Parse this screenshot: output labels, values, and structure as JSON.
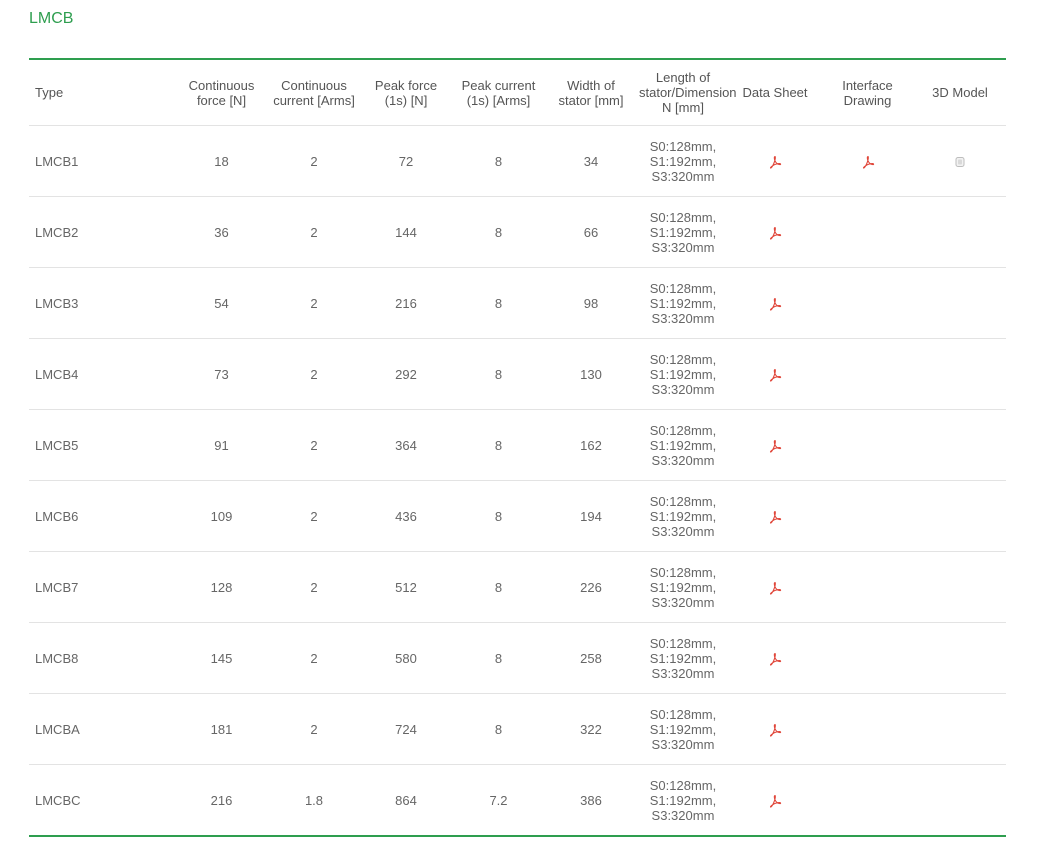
{
  "section_title": "LMCB",
  "headers": {
    "type": "Type",
    "cont_force": [
      "Continuous",
      "force [N]"
    ],
    "cont_current": [
      "Continuous",
      "current [Arms]"
    ],
    "peak_force": [
      "Peak force",
      "(1s) [N]"
    ],
    "peak_current": [
      "Peak current",
      "(1s) [Arms]"
    ],
    "width": [
      "Width of",
      "stator [mm]"
    ],
    "length": [
      "Length of",
      "stator/Dimension",
      "N [mm]"
    ],
    "datasheet": "Data Sheet",
    "interface": [
      "Interface",
      "Drawing"
    ],
    "model": "3D Model"
  },
  "rows": [
    {
      "type": "LMCB1",
      "cont_force": "18",
      "cont_current": "2",
      "peak_force": "72",
      "peak_current": "8",
      "width": "34",
      "length": [
        "S0:128mm,",
        "S1:192mm,",
        "S3:320mm"
      ],
      "datasheet": true,
      "interface": true,
      "model": true
    },
    {
      "type": "LMCB2",
      "cont_force": "36",
      "cont_current": "2",
      "peak_force": "144",
      "peak_current": "8",
      "width": "66",
      "length": [
        "S0:128mm,",
        "S1:192mm,",
        "S3:320mm"
      ],
      "datasheet": true,
      "interface": false,
      "model": false
    },
    {
      "type": "LMCB3",
      "cont_force": "54",
      "cont_current": "2",
      "peak_force": "216",
      "peak_current": "8",
      "width": "98",
      "length": [
        "S0:128mm,",
        "S1:192mm,",
        "S3:320mm"
      ],
      "datasheet": true,
      "interface": false,
      "model": false
    },
    {
      "type": "LMCB4",
      "cont_force": "73",
      "cont_current": "2",
      "peak_force": "292",
      "peak_current": "8",
      "width": "130",
      "length": [
        "S0:128mm,",
        "S1:192mm,",
        "S3:320mm"
      ],
      "datasheet": true,
      "interface": false,
      "model": false
    },
    {
      "type": "LMCB5",
      "cont_force": "91",
      "cont_current": "2",
      "peak_force": "364",
      "peak_current": "8",
      "width": "162",
      "length": [
        "S0:128mm,",
        "S1:192mm,",
        "S3:320mm"
      ],
      "datasheet": true,
      "interface": false,
      "model": false
    },
    {
      "type": "LMCB6",
      "cont_force": "109",
      "cont_current": "2",
      "peak_force": "436",
      "peak_current": "8",
      "width": "194",
      "length": [
        "S0:128mm,",
        "S1:192mm,",
        "S3:320mm"
      ],
      "datasheet": true,
      "interface": false,
      "model": false
    },
    {
      "type": "LMCB7",
      "cont_force": "128",
      "cont_current": "2",
      "peak_force": "512",
      "peak_current": "8",
      "width": "226",
      "length": [
        "S0:128mm,",
        "S1:192mm,",
        "S3:320mm"
      ],
      "datasheet": true,
      "interface": false,
      "model": false
    },
    {
      "type": "LMCB8",
      "cont_force": "145",
      "cont_current": "2",
      "peak_force": "580",
      "peak_current": "8",
      "width": "258",
      "length": [
        "S0:128mm,",
        "S1:192mm,",
        "S3:320mm"
      ],
      "datasheet": true,
      "interface": false,
      "model": false
    },
    {
      "type": "LMCBA",
      "cont_force": "181",
      "cont_current": "2",
      "peak_force": "724",
      "peak_current": "8",
      "width": "322",
      "length": [
        "S0:128mm,",
        "S1:192mm,",
        "S3:320mm"
      ],
      "datasheet": true,
      "interface": false,
      "model": false
    },
    {
      "type": "LMCBC",
      "cont_force": "216",
      "cont_current": "1.8",
      "peak_force": "864",
      "peak_current": "7.2",
      "width": "386",
      "length": [
        "S0:128mm,",
        "S1:192mm,",
        "S3:320mm"
      ],
      "datasheet": true,
      "interface": false,
      "model": false
    }
  ],
  "icons": {
    "pdf": "pdf-icon",
    "model": "3d-model-icon"
  },
  "colors": {
    "accent": "#2e9e4f",
    "pdf": "#e0463a"
  }
}
